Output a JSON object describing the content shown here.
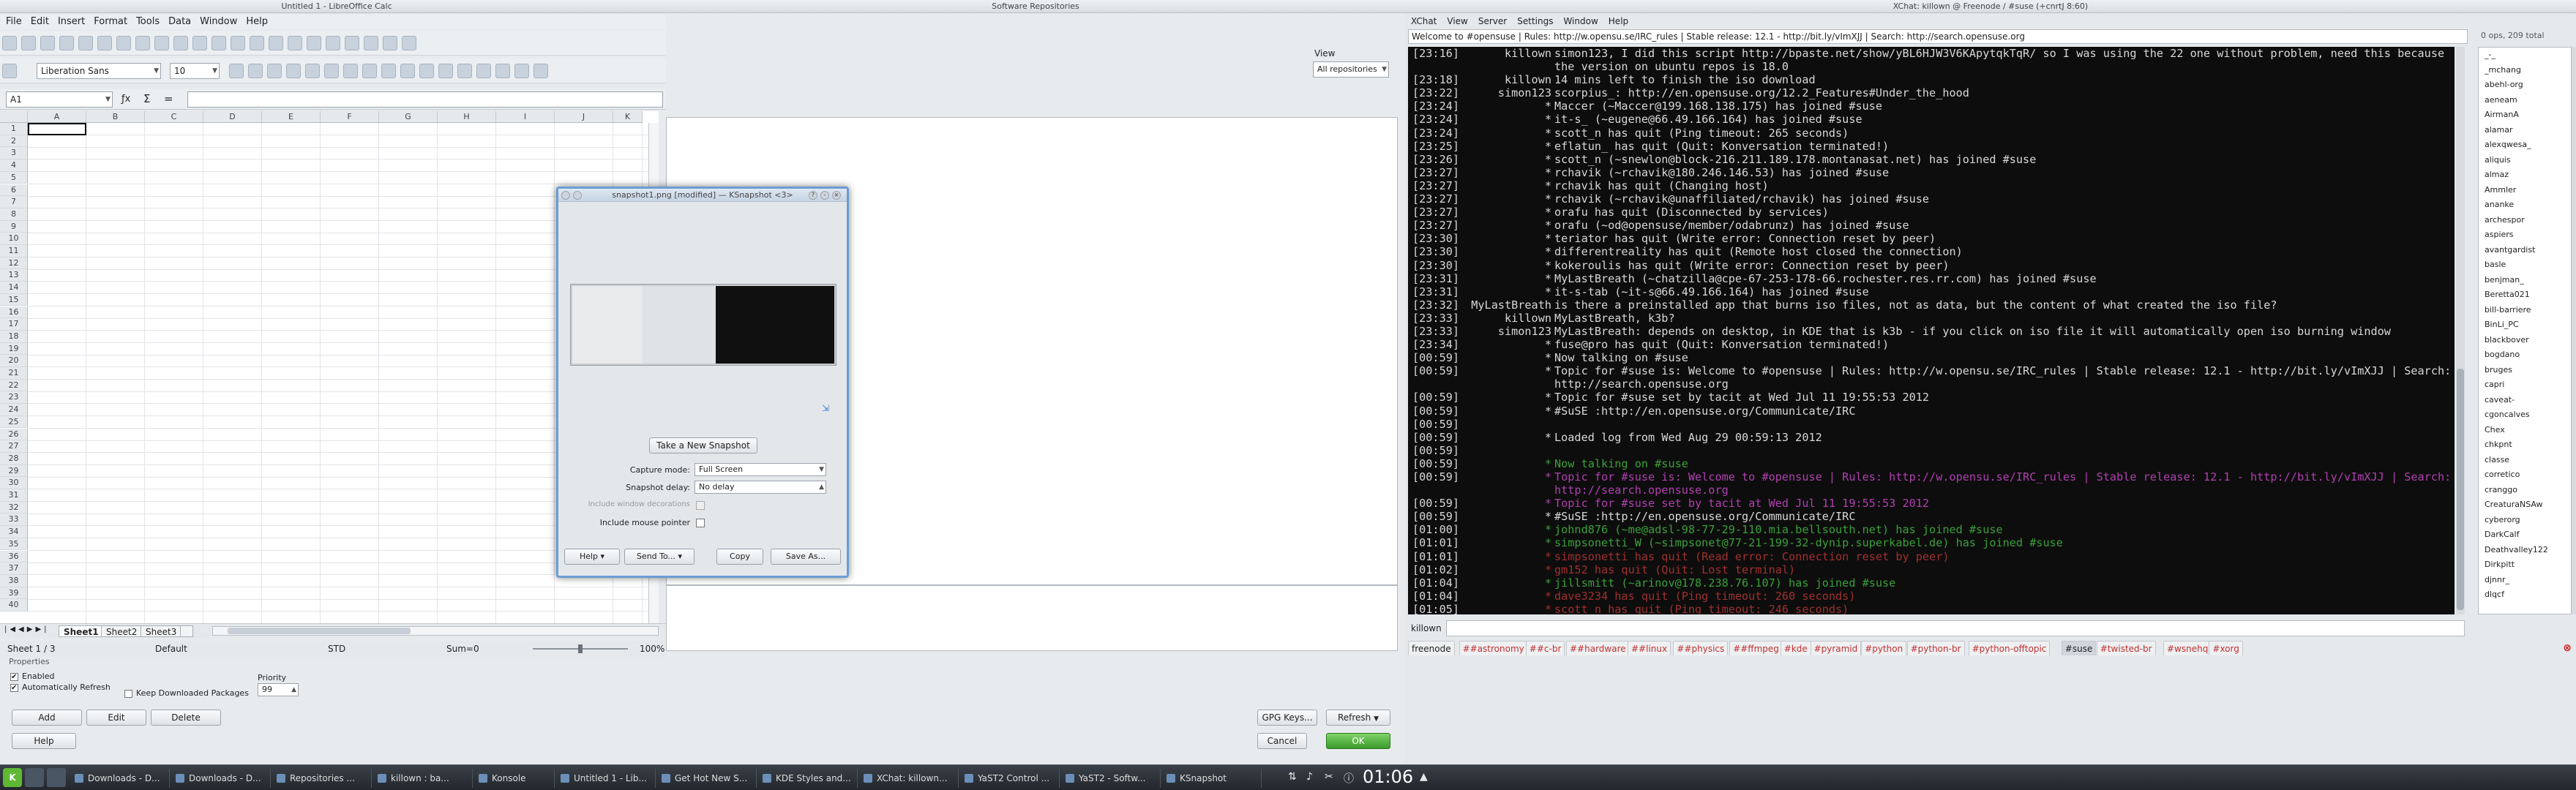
{
  "calc": {
    "title": "Untitled 1 - LibreOffice Calc",
    "menus": [
      "File",
      "Edit",
      "Insert",
      "Format",
      "Tools",
      "Data",
      "Window",
      "Help"
    ],
    "font_name": "Liberation Sans",
    "font_size": "10",
    "cell_ref": "A1",
    "columns": [
      "A",
      "B",
      "C",
      "D",
      "E",
      "F",
      "G",
      "H",
      "I",
      "J",
      "K"
    ],
    "rows": [
      "1",
      "2",
      "3",
      "4",
      "5",
      "6",
      "7",
      "8",
      "9",
      "10",
      "11",
      "12",
      "13",
      "14",
      "15",
      "16",
      "17",
      "18",
      "19",
      "20",
      "21",
      "22",
      "23",
      "24",
      "25",
      "26",
      "27",
      "28",
      "29",
      "30",
      "31",
      "32",
      "33",
      "34",
      "35",
      "36",
      "37",
      "38",
      "39",
      "40"
    ],
    "sheet_tabs": [
      "Sheet1",
      "Sheet2",
      "Sheet3"
    ],
    "status": {
      "sheet": "Sheet 1 / 3",
      "style": "Default",
      "mode": "STD",
      "sum": "Sum=0",
      "zoom": "100%"
    }
  },
  "repo": {
    "title": "Software Repositories",
    "view_label": "View",
    "view_value": "All repositories",
    "properties_label": "Properties",
    "enabled_label": "Enabled",
    "auto_refresh_label": "Automatically Refresh",
    "keep_pkgs_label": "Keep Downloaded Packages",
    "priority_label": "Priority",
    "priority_value": "99",
    "buttons": {
      "add": "Add",
      "edit": "Edit",
      "delete": "Delete",
      "help": "Help",
      "gpg": "GPG Keys...",
      "refresh": "Refresh",
      "cancel": "Cancel",
      "ok": "OK"
    }
  },
  "ksnapshot": {
    "title": "snapshot1.png [modified] — KSnapshot <3>",
    "new_snapshot": "Take a New Snapshot",
    "capture_mode_label": "Capture mode:",
    "capture_mode_value": "Full Screen",
    "delay_label": "Snapshot delay:",
    "delay_value": "No delay",
    "include_decorations_label": "Include window decorations",
    "include_pointer_label": "Include mouse pointer",
    "buttons": {
      "help": "Help",
      "send": "Send To...",
      "copy": "Copy",
      "save": "Save As..."
    }
  },
  "xchat": {
    "title": "XChat: killown @ Freenode / #suse (+cnrtJ 8:60)",
    "menus": [
      "XChat",
      "View",
      "Server",
      "Settings",
      "Window",
      "Help"
    ],
    "topic": "Welcome to #opensuse | Rules: http://w.opensu.se/IRC_rules | Stable release: 12.1 - http://bit.ly/vImXJJ | Search: http://search.opensuse.org",
    "ops_count": "0 ops, 209 total",
    "nick": "killown",
    "lines": [
      {
        "ts": "[23:16]",
        "nick": "killown",
        "text": "simon123, I did this script http://bpaste.net/show/yBL6HJW3V6KApytqkTqR/ so I was using the 22 one without problem, need this because",
        "color": "#d8d8d8"
      },
      {
        "ts": "",
        "nick": "",
        "text": "the version on ubuntu repos is 18.0",
        "color": "#d8d8d8"
      },
      {
        "ts": "[23:18]",
        "nick": "killown",
        "text": "14 mins left to finish the iso download",
        "color": "#d8d8d8"
      },
      {
        "ts": "[23:22]",
        "nick": "simon123",
        "text": "scorpius_: http://en.opensuse.org/12.2_Features#Under_the_hood",
        "color": "#d8d8d8"
      },
      {
        "ts": "[23:24]",
        "nick": "*",
        "text": "Maccer (~Maccer@199.168.138.175) has joined #suse",
        "color": "#d8d8d8"
      },
      {
        "ts": "[23:24]",
        "nick": "*",
        "text": "it-s_ (~eugene@66.49.166.164) has joined #suse",
        "color": "#d8d8d8"
      },
      {
        "ts": "[23:24]",
        "nick": "*",
        "text": "scott_n has quit (Ping timeout: 265 seconds)",
        "color": "#d8d8d8"
      },
      {
        "ts": "[23:25]",
        "nick": "*",
        "text": "eflatun_ has quit (Quit: Konversation terminated!)",
        "color": "#d8d8d8"
      },
      {
        "ts": "[23:26]",
        "nick": "*",
        "text": "scott_n (~snewlon@block-216.211.189.178.montanasat.net) has joined #suse",
        "color": "#d8d8d8"
      },
      {
        "ts": "[23:27]",
        "nick": "*",
        "text": "rchavik (~rchavik@180.246.146.53) has joined #suse",
        "color": "#d8d8d8"
      },
      {
        "ts": "[23:27]",
        "nick": "*",
        "text": "rchavik has quit (Changing host)",
        "color": "#d8d8d8"
      },
      {
        "ts": "[23:27]",
        "nick": "*",
        "text": "rchavik (~rchavik@unaffiliated/rchavik) has joined #suse",
        "color": "#d8d8d8"
      },
      {
        "ts": "[23:27]",
        "nick": "*",
        "text": "orafu has quit (Disconnected by services)",
        "color": "#d8d8d8"
      },
      {
        "ts": "[23:27]",
        "nick": "*",
        "text": "orafu (~od@opensuse/member/odabrunz) has joined #suse",
        "color": "#d8d8d8"
      },
      {
        "ts": "[23:30]",
        "nick": "*",
        "text": "teriator has quit (Write error: Connection reset by peer)",
        "color": "#d8d8d8"
      },
      {
        "ts": "[23:30]",
        "nick": "*",
        "text": "differentreality has quit (Remote host closed the connection)",
        "color": "#d8d8d8"
      },
      {
        "ts": "[23:30]",
        "nick": "*",
        "text": "kokeroulis has quit (Write error: Connection reset by peer)",
        "color": "#d8d8d8"
      },
      {
        "ts": "[23:31]",
        "nick": "*",
        "text": "MyLastBreath (~chatzilla@cpe-67-253-178-66.rochester.res.rr.com) has joined #suse",
        "color": "#d8d8d8"
      },
      {
        "ts": "[23:31]",
        "nick": "*",
        "text": "it-s-tab (~it-s@66.49.166.164) has joined #suse",
        "color": "#d8d8d8"
      },
      {
        "ts": "[23:32]",
        "nick": "MyLastBreath",
        "text": "is there a preinstalled app that burns iso files, not as data, but the content of what created the iso file?",
        "color": "#d8d8d8"
      },
      {
        "ts": "[23:33]",
        "nick": "killown",
        "text": "MyLastBreath, k3b?",
        "color": "#d8d8d8"
      },
      {
        "ts": "[23:33]",
        "nick": "simon123",
        "text": "MyLastBreath: depends on desktop, in KDE that is k3b - if you click on iso file it will automatically open iso burning window",
        "color": "#d8d8d8"
      },
      {
        "ts": "[23:34]",
        "nick": "*",
        "text": "fuse@pro has quit (Quit: Konversation terminated!)",
        "color": "#d8d8d8"
      },
      {
        "ts": "[00:59]",
        "nick": "*",
        "text": "Now talking on #suse",
        "color": "#d8d8d8"
      },
      {
        "ts": "[00:59]",
        "nick": "*",
        "text": "Topic for #suse is: Welcome to #opensuse | Rules: http://w.opensu.se/IRC_rules | Stable release: 12.1 - http://bit.ly/vImXJJ | Search:",
        "color": "#d8d8d8"
      },
      {
        "ts": "",
        "nick": "",
        "text": "http://search.opensuse.org",
        "color": "#d8d8d8"
      },
      {
        "ts": "[00:59]",
        "nick": "*",
        "text": "Topic for #suse set by tacit at Wed Jul 11 19:55:53 2012",
        "color": "#d8d8d8"
      },
      {
        "ts": "[00:59]",
        "nick": "*",
        "text": "#SuSE :http://en.opensuse.org/Communicate/IRC",
        "color": "#d8d8d8"
      },
      {
        "ts": "[00:59]",
        "nick": "",
        "text": "",
        "color": "#d8d8d8"
      },
      {
        "ts": "[00:59]",
        "nick": "*",
        "text": "Loaded log from Wed Aug 29 00:59:13 2012",
        "color": "#d8d8d8"
      },
      {
        "ts": "[00:59]",
        "nick": "",
        "text": "",
        "color": "#d8d8d8"
      },
      {
        "ts": "[00:59]",
        "nick": "*",
        "text": "Now talking on #suse",
        "color": "#3aa03a"
      },
      {
        "ts": "[00:59]",
        "nick": "*",
        "text": "Topic for #suse is: Welcome to #opensuse | Rules: http://w.opensu.se/IRC_rules | Stable release: 12.1 - http://bit.ly/vImXJJ | Search:",
        "color": "#b040b0"
      },
      {
        "ts": "",
        "nick": "",
        "text": "http://search.opensuse.org",
        "color": "#b040b0"
      },
      {
        "ts": "[00:59]",
        "nick": "*",
        "text": "Topic for #suse set by tacit at Wed Jul 11 19:55:53 2012",
        "color": "#b040b0"
      },
      {
        "ts": "[00:59]",
        "nick": "*",
        "text": "#SuSE :http://en.opensuse.org/Communicate/IRC",
        "color": "#d8d8d8"
      },
      {
        "ts": "[01:00]",
        "nick": "*",
        "text": "johnd876 (~me@adsl-98-77-29-110.mia.bellsouth.net) has joined #suse",
        "color": "#3aa03a"
      },
      {
        "ts": "[01:01]",
        "nick": "*",
        "text": "simpsonetti_W (~simpsonet@77-21-199-32-dynip.superkabel.de) has joined #suse",
        "color": "#3aa03a"
      },
      {
        "ts": "[01:01]",
        "nick": "*",
        "text": "simpsonetti has quit (Read error: Connection reset by peer)",
        "color": "#a03030"
      },
      {
        "ts": "[01:02]",
        "nick": "*",
        "text": "gm152 has quit (Quit: Lost terminal)",
        "color": "#a03030"
      },
      {
        "ts": "[01:04]",
        "nick": "*",
        "text": "jillsmitt (~arinov@178.238.76.107) has joined #suse",
        "color": "#3aa03a"
      },
      {
        "ts": "[01:04]",
        "nick": "*",
        "text": "dave3234 has quit (Ping timeout: 260 seconds)",
        "color": "#a03030"
      },
      {
        "ts": "[01:05]",
        "nick": "*",
        "text": "scott_n has quit (Ping timeout: 246 seconds)",
        "color": "#a03030"
      }
    ],
    "users": [
      "_-_",
      "_mchang",
      "abehl-org",
      "aeneam",
      "AirmanA",
      "alamar",
      "alexqwesa_",
      "aliquis",
      "almaz",
      "Ammler",
      "ananke",
      "archespor",
      "aspiers",
      "avantgardist",
      "basle",
      "benjman_",
      "Beretta021",
      "bill-barriere",
      "BinLi_PC",
      "blackbover",
      "bogdano",
      "bruges",
      "capri",
      "caveat-",
      "cgoncalves",
      "Chex",
      "chkpnt",
      "classe",
      "corretico",
      "cranggo",
      "CreaturaNSAw",
      "cyberorg",
      "DarkCalf",
      "Deathvalley122",
      "Dirkpitt",
      "djnnr_",
      "dlqcf"
    ],
    "channels": [
      "freenode",
      "##astronomy",
      "##c-br",
      "##hardware",
      "##linux",
      "##physics",
      "##ffmpeg",
      "#kde",
      "#pyramid",
      "#python",
      "#python-br",
      "#python-offtopic",
      "#suse",
      "#twisted-br",
      "#wsnehq",
      "#xorg"
    ],
    "active_channel": "#suse"
  },
  "taskbar": {
    "tasks": [
      "Downloads - D...",
      "Downloads - D...",
      "Repositories ...",
      "killown : ba...",
      "Konsole",
      "Untitled 1 - Lib...",
      "Get Hot New S...",
      "KDE Styles and...",
      "XChat: killown...",
      "YaST2 Control ...",
      "YaST2 - Softw...",
      "KSnapshot"
    ],
    "clock": "01:06"
  }
}
